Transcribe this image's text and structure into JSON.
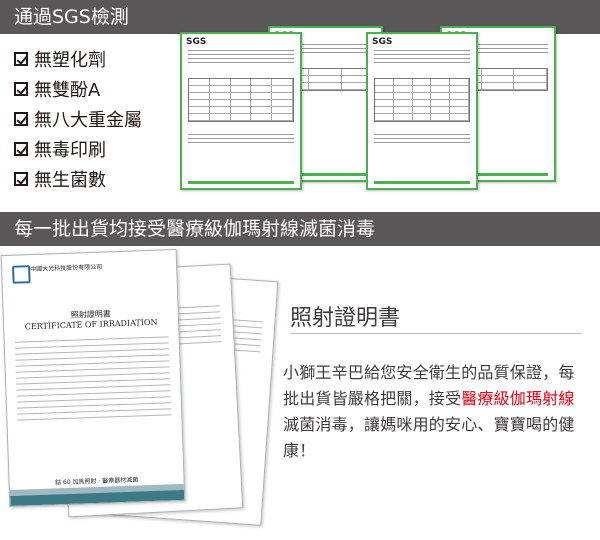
{
  "header": {
    "title": "通過SGS檢測"
  },
  "checklist": [
    "無塑化劑",
    "無雙酚A",
    "無八大重金屬",
    "無毒印刷",
    "無生菌數"
  ],
  "sgs_docs": {
    "logo": "SGS"
  },
  "section2": {
    "title": "每一批出貨均接受醫療級伽瑪射線滅菌消毒"
  },
  "irradiation_doc": {
    "company": "中國大光科技股份有限公司",
    "title_zh": "照射證明書",
    "title_en": "CERTIFICATE OF IRRADIATION",
    "footer": "鈷 60 加馬照射 · 醫療器材滅菌"
  },
  "certificate": {
    "title": "照射證明書",
    "body_1": "小獅王辛巴給您安全衛生的品質保證，每批出貨皆嚴格把關，接受",
    "body_highlight": "醫療級伽瑪射線",
    "body_2": "滅菌消毒，讓媽咪用的安心、寶寶喝的健康！",
    "highlight_color": "#e60012"
  }
}
